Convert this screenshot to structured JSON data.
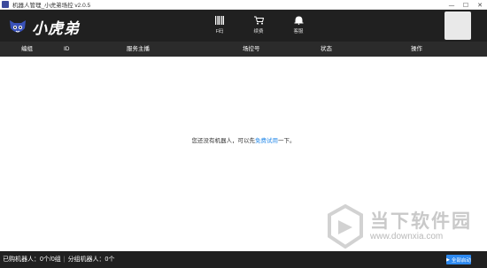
{
  "window": {
    "title": "机器人管理_小虎弟场控 v2.0.5",
    "controls": {
      "minimize": "—",
      "maximize": "☐",
      "close": "✕"
    }
  },
  "header": {
    "logo_text": "小虎弟",
    "nav": [
      {
        "label": "F码",
        "icon": "barcode-icon"
      },
      {
        "label": "续费",
        "icon": "cart-icon"
      },
      {
        "label": "客服",
        "icon": "bell-service-icon"
      }
    ]
  },
  "table": {
    "columns": [
      "编组",
      "ID",
      "服务主播",
      "场控号",
      "状态",
      "操作"
    ]
  },
  "empty_state": {
    "prefix": "您还没有机器人，可以先",
    "link": "免费试用",
    "suffix": "一下。"
  },
  "watermark": {
    "text_cn": "当下软件园",
    "url": "www.downxia.com"
  },
  "statusbar": {
    "purchased": "已购机器人：0个/0组",
    "separator": "|",
    "assigned": "分组机器人：0个",
    "start_all_label": "全部启动",
    "start_all_icon": "▶"
  },
  "colors": {
    "header_bg": "#202020",
    "colhead_bg": "#2b2b2b",
    "link": "#2a8cea",
    "button": "#2d89ef"
  }
}
